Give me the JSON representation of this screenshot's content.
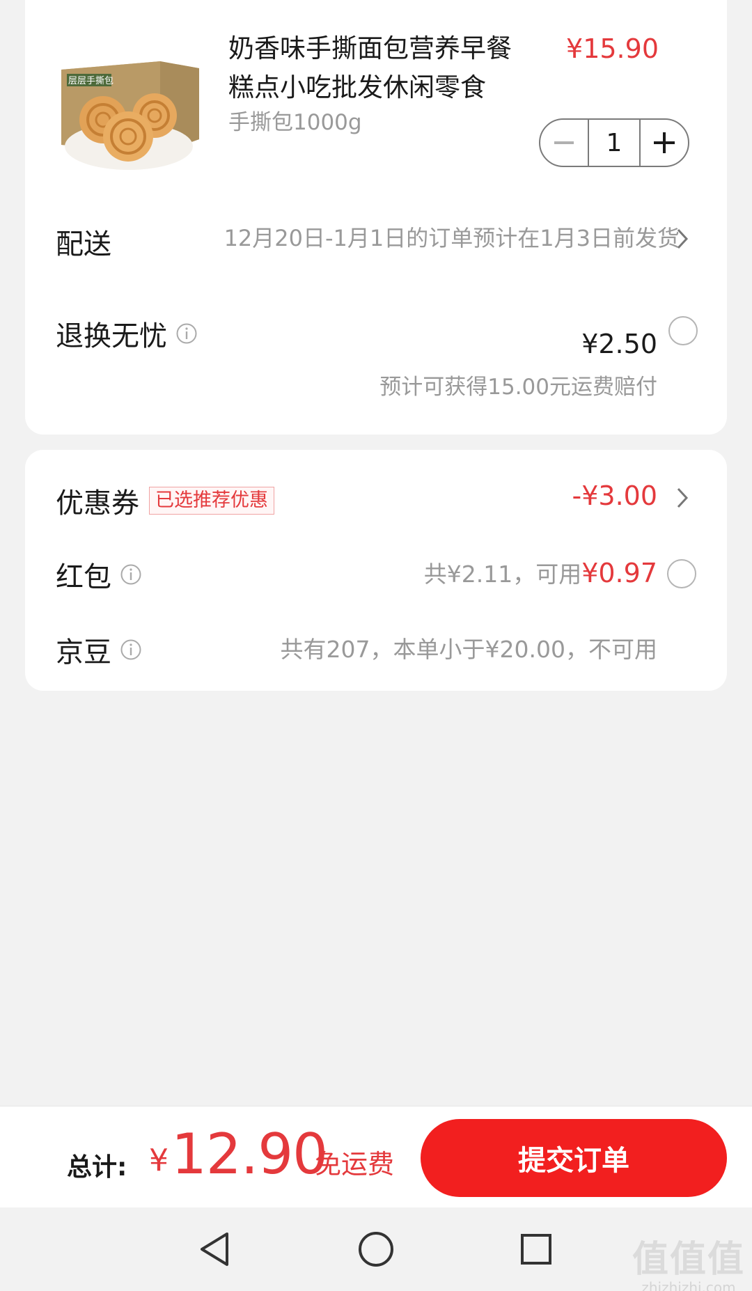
{
  "product": {
    "title": "奶香味手撕面包营养早餐糕点小吃批发休闲零食",
    "price": "¥15.90",
    "spec": "手撕包1000g",
    "box_text": "层层手撕包",
    "quantity": "1",
    "minus_label": "−",
    "plus_label": "+"
  },
  "delivery": {
    "label": "配送",
    "text": "12月20日-1月1日的订单预计在1月3日前发货"
  },
  "insurance": {
    "label": "退换无忧",
    "price": "¥2.50",
    "sub": "预计可获得15.00元运费赔付"
  },
  "coupon": {
    "label": "优惠券",
    "tag": "已选推荐优惠",
    "amount": "-¥3.00"
  },
  "hongbao": {
    "label": "红包",
    "text": "共¥2.11，可用",
    "available": "¥0.97"
  },
  "jingdou": {
    "label": "京豆",
    "text": "共有207，本单小于¥20.00，不可用"
  },
  "footer": {
    "total_label": "总计:",
    "currency": "¥",
    "total": "12.90",
    "shipping": "免运费",
    "submit_label": "提交订单"
  },
  "watermark": {
    "big": "值值值",
    "small": "zhizhizhi.com"
  },
  "colors": {
    "accent": "#e4393c",
    "submit": "#f21f1f",
    "muted": "#999999",
    "background": "#f2f2f2"
  }
}
